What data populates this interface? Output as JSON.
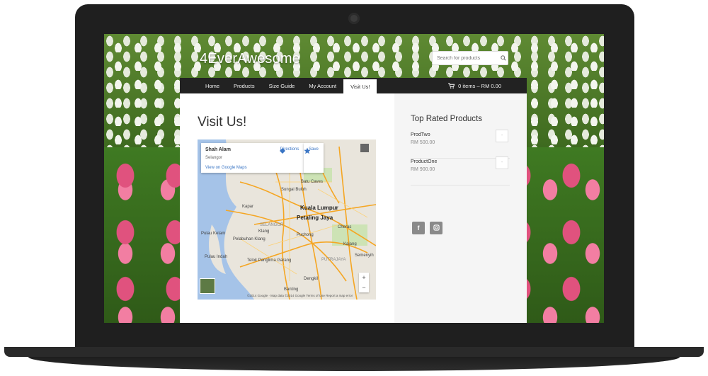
{
  "site": {
    "title": "4EverAwesome",
    "search_placeholder": "Search for products"
  },
  "nav": {
    "items": [
      {
        "label": "Home"
      },
      {
        "label": "Products"
      },
      {
        "label": "Size Guide"
      },
      {
        "label": "My Account"
      },
      {
        "label": "Visit Us!"
      }
    ],
    "active": "Visit Us!",
    "cart_label": "0 items – RM 0.00"
  },
  "main": {
    "title": "Visit Us!",
    "map": {
      "place_name": "Shah Alam",
      "region": "Selangor",
      "link": "View on Google Maps",
      "directions_label": "Directions",
      "save_label": "Save",
      "labels": {
        "batu_caves": "Batu Caves",
        "sungai_buloh": "Sungai Buloh",
        "kuala_lumpur": "Kuala Lumpur",
        "petaling_jaya": "Petaling Jaya",
        "klang": "Klang",
        "puchong": "Puchong",
        "cheras": "Cheras",
        "kajang": "Kajang",
        "semenyih": "Semenyih",
        "putrajaya": "PUTRAJAYA",
        "pelabuhan_klang": "Pelabuhan Klang",
        "pulau_indah": "Pulau Indah",
        "pulau_ketam": "Pulau Ketam",
        "telok_panglima_garang": "Telok Panglima Garang",
        "banting": "Banting",
        "kapar": "Kapar",
        "dengkil": "Dengkil",
        "selangor": "SELANGOR"
      },
      "zoom_in": "+",
      "zoom_out": "−",
      "footer": "©2014 Google · Map data ©2014 Google   Terms of Use   Report a map error"
    }
  },
  "sidebar": {
    "title": "Top Rated Products",
    "products": [
      {
        "name": "ProdTwo",
        "price": "RM 500.00"
      },
      {
        "name": "ProductOne",
        "price": "RM 900.00"
      }
    ],
    "social_icons": [
      "facebook-icon",
      "instagram-icon"
    ]
  },
  "colors": {
    "nav_bg": "#222222",
    "sidebar_bg": "#f5f5f5",
    "link_blue": "#3a75c4",
    "social_grey": "#8a8a8a"
  }
}
